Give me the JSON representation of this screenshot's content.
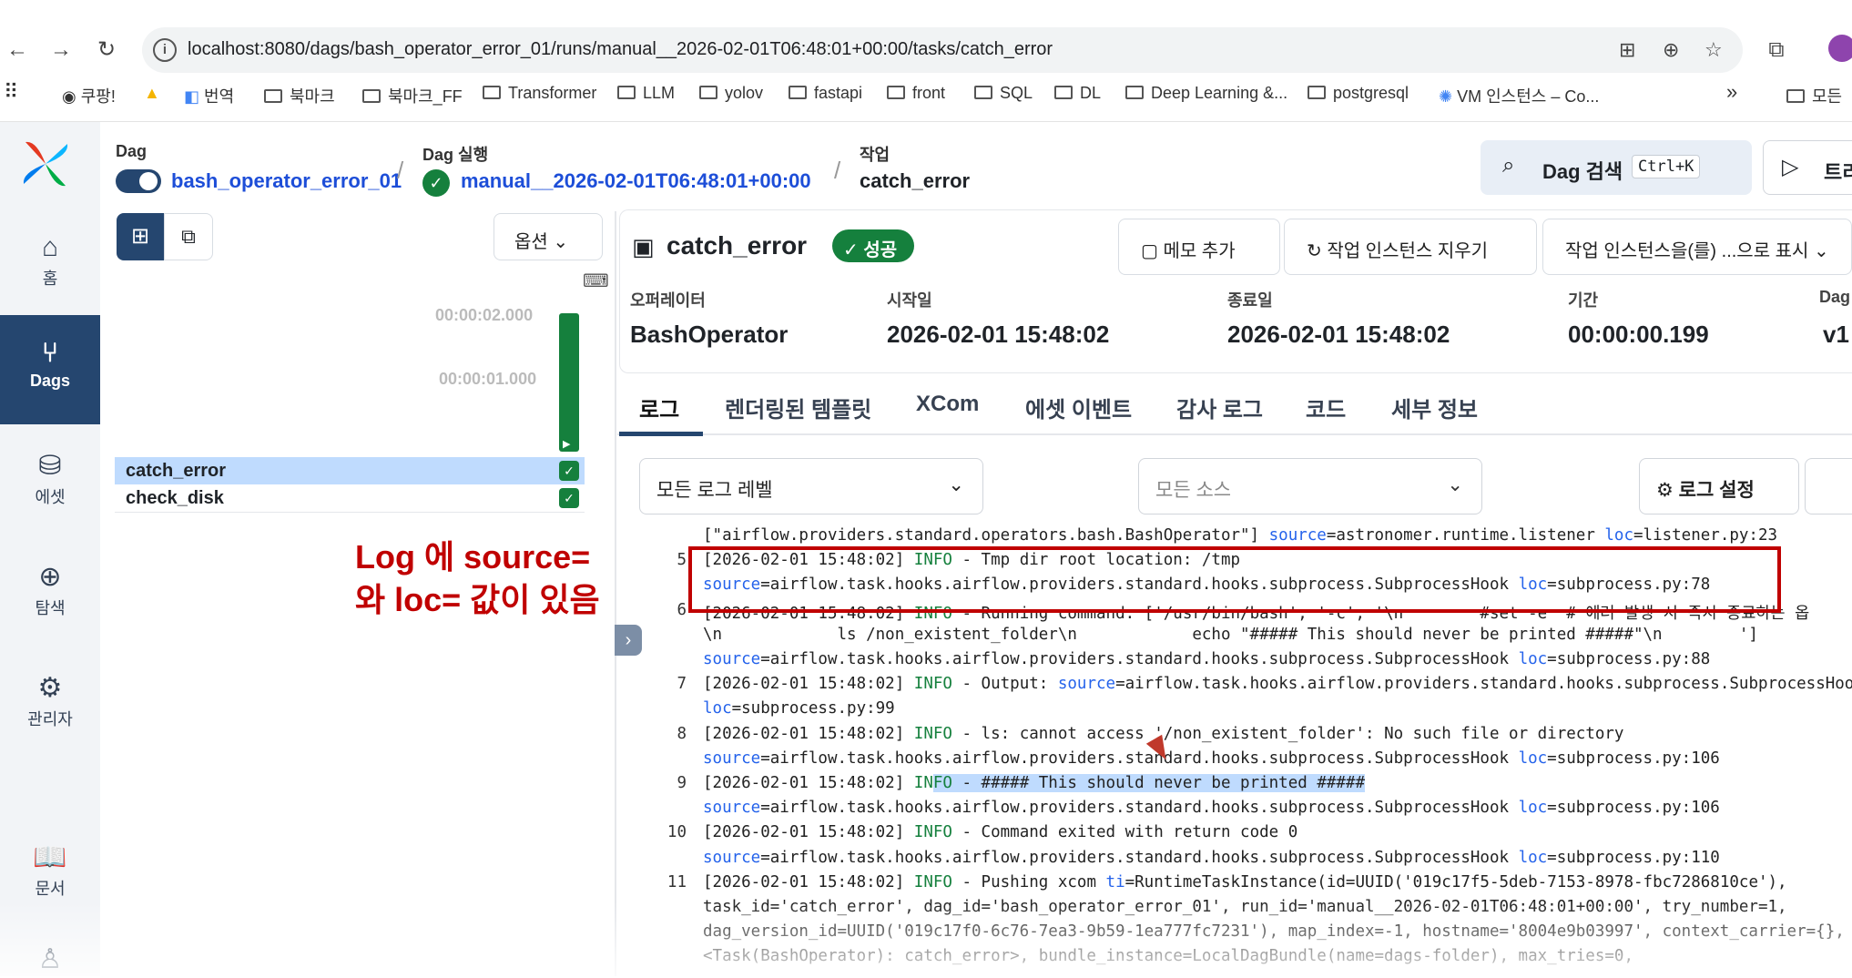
{
  "browser": {
    "url": "localhost:8080/dags/bash_operator_error_01/runs/manual__2026-02-01T06:48:01+00:00/tasks/catch_error",
    "bookmarks": [
      "쿠팡!",
      "번역",
      "북마크",
      "북마크_FF",
      "Transformer",
      "LLM",
      "yolov",
      "fastapi",
      "front",
      "SQL",
      "DL",
      "Deep Learning &...",
      "postgresql",
      "VM 인스턴스 – Co...",
      "모든"
    ]
  },
  "nav": {
    "home": "홈",
    "dags": "Dags",
    "assets": "에셋",
    "browse": "탐색",
    "admin": "관리자",
    "docs": "문서"
  },
  "header": {
    "dag_label": "Dag",
    "dag_value": "bash_operator_error_01",
    "run_label": "Dag 실행",
    "run_value": "manual__2026-02-01T06:48:01+00:00",
    "task_label": "작업",
    "task_value": "catch_error",
    "search_label": "Dag 검색",
    "search_shortcut": "Ctrl+K",
    "trigger_label": "트리"
  },
  "left_panel": {
    "options_label": "옵션",
    "duration_ticks": [
      "00:00:02.000",
      "00:00:01.000"
    ],
    "tasks": [
      "catch_error",
      "check_disk"
    ]
  },
  "task": {
    "title": "catch_error",
    "state": "성공",
    "buttons": [
      "메모 추가",
      "작업 인스턴스 지우기",
      "작업 인스턴스을(를) ...으로 표시"
    ],
    "operator_label": "오퍼레이터",
    "operator_value": "BashOperator",
    "start_label": "시작일",
    "start_value": "2026-02-01 15:48:02",
    "end_label": "종료일",
    "end_value": "2026-02-01 15:48:02",
    "duration_label": "기간",
    "duration_value": "00:00:00.199",
    "dag_version_label": "Dag",
    "dag_version_value": "v1"
  },
  "tabs": [
    "로그",
    "렌더링된 템플릿",
    "XCom",
    "에셋 이벤트",
    "감사 로그",
    "코드",
    "세부 정보"
  ],
  "log_controls": {
    "level": "모든 로그 레벨",
    "source": "모든 소스",
    "settings": "로그 설정"
  },
  "annotation": [
    "Log 에 source=",
    "와 loc= 값이 있음"
  ],
  "log_lines": [
    {
      "n": "",
      "parts": [
        [
          "",
          "[\"airflow.providers.standard.operators.bash.BashOperator\"] "
        ],
        [
          "key",
          "source"
        ],
        [
          "",
          "=astronomer.runtime.listener "
        ],
        [
          "key",
          "loc"
        ],
        [
          "",
          "=listener.py:23"
        ]
      ]
    },
    {
      "n": "5",
      "parts": [
        [
          "",
          "[2026-02-01 15:48:02] "
        ],
        [
          "info",
          "INFO"
        ],
        [
          "",
          " - Tmp dir root location: /tmp"
        ]
      ]
    },
    {
      "n": "",
      "parts": [
        [
          "key",
          "source"
        ],
        [
          "",
          "=airflow.task.hooks.airflow.providers.standard.hooks.subprocess.SubprocessHook "
        ],
        [
          "key",
          "loc"
        ],
        [
          "",
          "=subprocess.py:78"
        ]
      ]
    },
    {
      "n": "6",
      "parts": [
        [
          "",
          "[2026-02-01 15:48:02] "
        ],
        [
          "info",
          "INFO"
        ],
        [
          "",
          " - Running command: ['/usr/bin/bash', '-c', '\\n        #set -e  # 에러 발생 시 즉시 종료하는 옵"
        ]
      ]
    },
    {
      "n": "",
      "parts": [
        [
          "",
          "\\n            ls /non_existent_folder\\n            echo \"##### This should never be printed #####\"\\n        ']"
        ]
      ]
    },
    {
      "n": "",
      "parts": [
        [
          "key",
          "source"
        ],
        [
          "",
          "=airflow.task.hooks.airflow.providers.standard.hooks.subprocess.SubprocessHook "
        ],
        [
          "key",
          "loc"
        ],
        [
          "",
          "=subprocess.py:88"
        ]
      ]
    },
    {
      "n": "7",
      "parts": [
        [
          "",
          "[2026-02-01 15:48:02] "
        ],
        [
          "info",
          "INFO"
        ],
        [
          "",
          " - Output: "
        ],
        [
          "key",
          "source"
        ],
        [
          "",
          "=airflow.task.hooks.airflow.providers.standard.hooks.subprocess.SubprocessHook"
        ]
      ]
    },
    {
      "n": "",
      "parts": [
        [
          "key",
          "loc"
        ],
        [
          "",
          "=subprocess.py:99"
        ]
      ]
    },
    {
      "n": "8",
      "parts": [
        [
          "",
          "[2026-02-01 15:48:02] "
        ],
        [
          "info",
          "INFO"
        ],
        [
          "",
          " - ls: cannot access '/non_existent_folder': No such file or directory"
        ]
      ]
    },
    {
      "n": "",
      "parts": [
        [
          "key",
          "source"
        ],
        [
          "",
          "=airflow.task.hooks.airflow.providers.standard.hooks.subprocess.SubprocessHook "
        ],
        [
          "key",
          "loc"
        ],
        [
          "",
          "=subprocess.py:106"
        ]
      ]
    },
    {
      "n": "9",
      "parts": [
        [
          "",
          "[2026-02-01 15:48:02] "
        ],
        [
          "info",
          "IN"
        ],
        [
          "info hl",
          "FO"
        ],
        [
          "hl",
          " - ##### This should never be printed #####"
        ]
      ]
    },
    {
      "n": "",
      "parts": [
        [
          "key",
          "source"
        ],
        [
          "",
          "=airflow.task.hooks.airflow.providers.standard.hooks.subprocess.SubprocessHook "
        ],
        [
          "key",
          "loc"
        ],
        [
          "",
          "=subprocess.py:106"
        ]
      ]
    },
    {
      "n": "10",
      "parts": [
        [
          "",
          "[2026-02-01 15:48:02] "
        ],
        [
          "info",
          "INFO"
        ],
        [
          "",
          " - Command exited with return code 0"
        ]
      ]
    },
    {
      "n": "",
      "parts": [
        [
          "key",
          "source"
        ],
        [
          "",
          "=airflow.task.hooks.airflow.providers.standard.hooks.subprocess.SubprocessHook "
        ],
        [
          "key",
          "loc"
        ],
        [
          "",
          "=subprocess.py:110"
        ]
      ]
    },
    {
      "n": "11",
      "parts": [
        [
          "",
          "[2026-02-01 15:48:02] "
        ],
        [
          "info",
          "INFO"
        ],
        [
          "",
          " - Pushing xcom "
        ],
        [
          "key",
          "ti"
        ],
        [
          "",
          "=RuntimeTaskInstance(id=UUID('019c17f5-5deb-7153-8978-fbc7286810ce'),"
        ]
      ]
    },
    {
      "n": "",
      "parts": [
        [
          "",
          "task_id='catch_error', dag_id='bash_operator_error_01', run_id='manual__2026-02-01T06:48:01+00:00', try_number=1,"
        ]
      ]
    },
    {
      "n": "",
      "parts": [
        [
          "",
          "dag_version_id=UUID('019c17f0-6c76-7ea3-9b59-1ea777fc7231'), map_index=-1, hostname='8004e9b03997', context_carrier={}, task="
        ]
      ]
    },
    {
      "n": "",
      "parts": [
        [
          "",
          "<Task(BashOperator): catch_error>, bundle_instance=LocalDagBundle(name=dags-folder), max_tries=0,"
        ]
      ]
    }
  ],
  "colors": {
    "brand": "#25466f",
    "link": "#1d4ed8",
    "success": "#15803d",
    "annotation": "#c00000"
  }
}
